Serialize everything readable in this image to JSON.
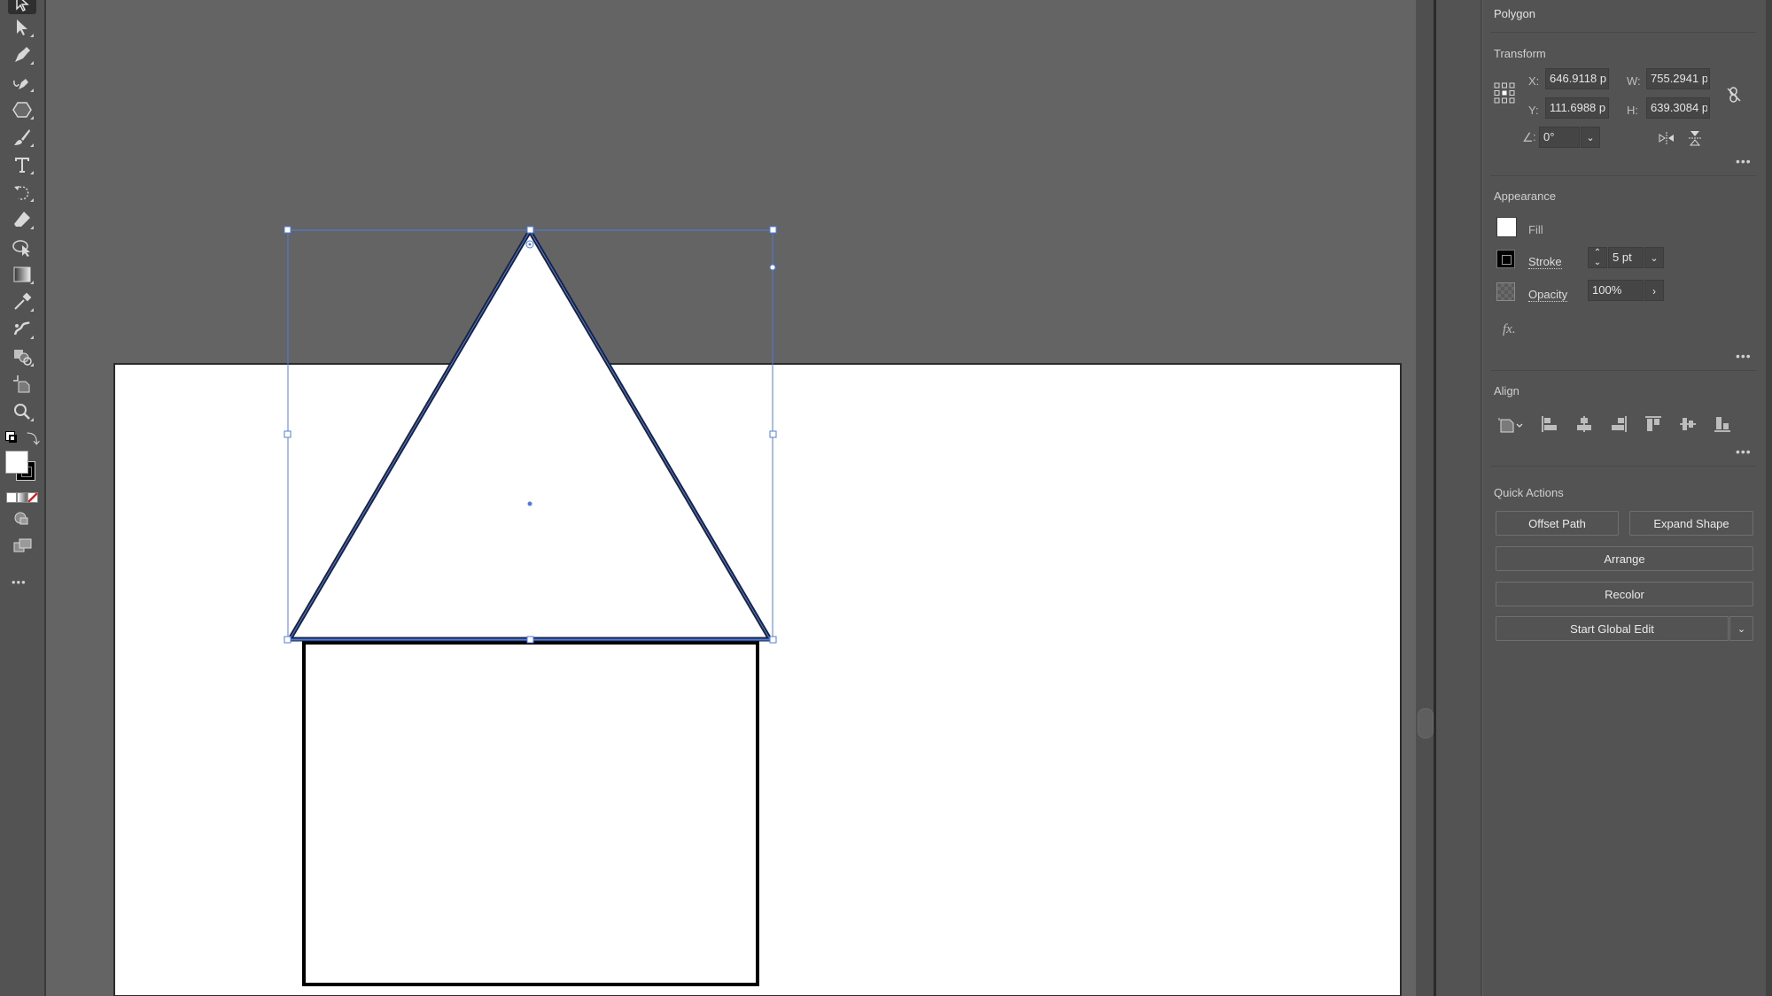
{
  "toolbar": {
    "tools": [
      {
        "name": "selection-tool",
        "active": true
      },
      {
        "name": "direct-selection-tool"
      },
      {
        "name": "pen-tool"
      },
      {
        "name": "curvature-tool"
      },
      {
        "name": "polygon-tool"
      },
      {
        "name": "paintbrush-tool"
      },
      {
        "name": "type-tool"
      },
      {
        "name": "rotate-tool"
      },
      {
        "name": "eraser-tool"
      },
      {
        "name": "puppet-warp-tool"
      },
      {
        "name": "gradient-tool"
      },
      {
        "name": "eyedropper-tool"
      },
      {
        "name": "blend-tool"
      },
      {
        "name": "shape-builder-tool"
      },
      {
        "name": "artboard-tool"
      },
      {
        "name": "zoom-tool"
      }
    ],
    "more_label": "•••"
  },
  "canvas": {
    "background": "#646464",
    "artboard_color": "#ffffff",
    "selection_color": "#4f7ddf",
    "selected_object": "Polygon",
    "objects": [
      {
        "type": "polygon",
        "sides": 3,
        "fill": "#ffffff",
        "stroke": "#1a2340",
        "stroke_pt": 5,
        "selected": true
      },
      {
        "type": "rectangle",
        "fill": "#ffffff",
        "stroke": "#000000",
        "selected": false
      }
    ]
  },
  "panel": {
    "title": "Polygon",
    "transform": {
      "heading": "Transform",
      "x_label": "X:",
      "x_value": "646.9118 p",
      "y_label": "Y:",
      "y_value": "111.6988 p",
      "w_label": "W:",
      "w_value": "755.2941 p",
      "h_label": "H:",
      "h_value": "639.3084 p",
      "angle_label": ":",
      "angle_value": "0°",
      "more": "•••"
    },
    "appearance": {
      "heading": "Appearance",
      "fill_label": "Fill",
      "fill_color": "#ffffff",
      "stroke_label": "Stroke",
      "stroke_value": "5 pt",
      "opacity_label": "Opacity",
      "opacity_value": "100%",
      "fx_label": "fx.",
      "more": "•••"
    },
    "align": {
      "heading": "Align",
      "more": "•••"
    },
    "quick_actions": {
      "heading": "Quick Actions",
      "offset_path": "Offset Path",
      "expand_shape": "Expand Shape",
      "arrange": "Arrange",
      "recolor": "Recolor",
      "start_global_edit": "Start Global Edit"
    }
  }
}
